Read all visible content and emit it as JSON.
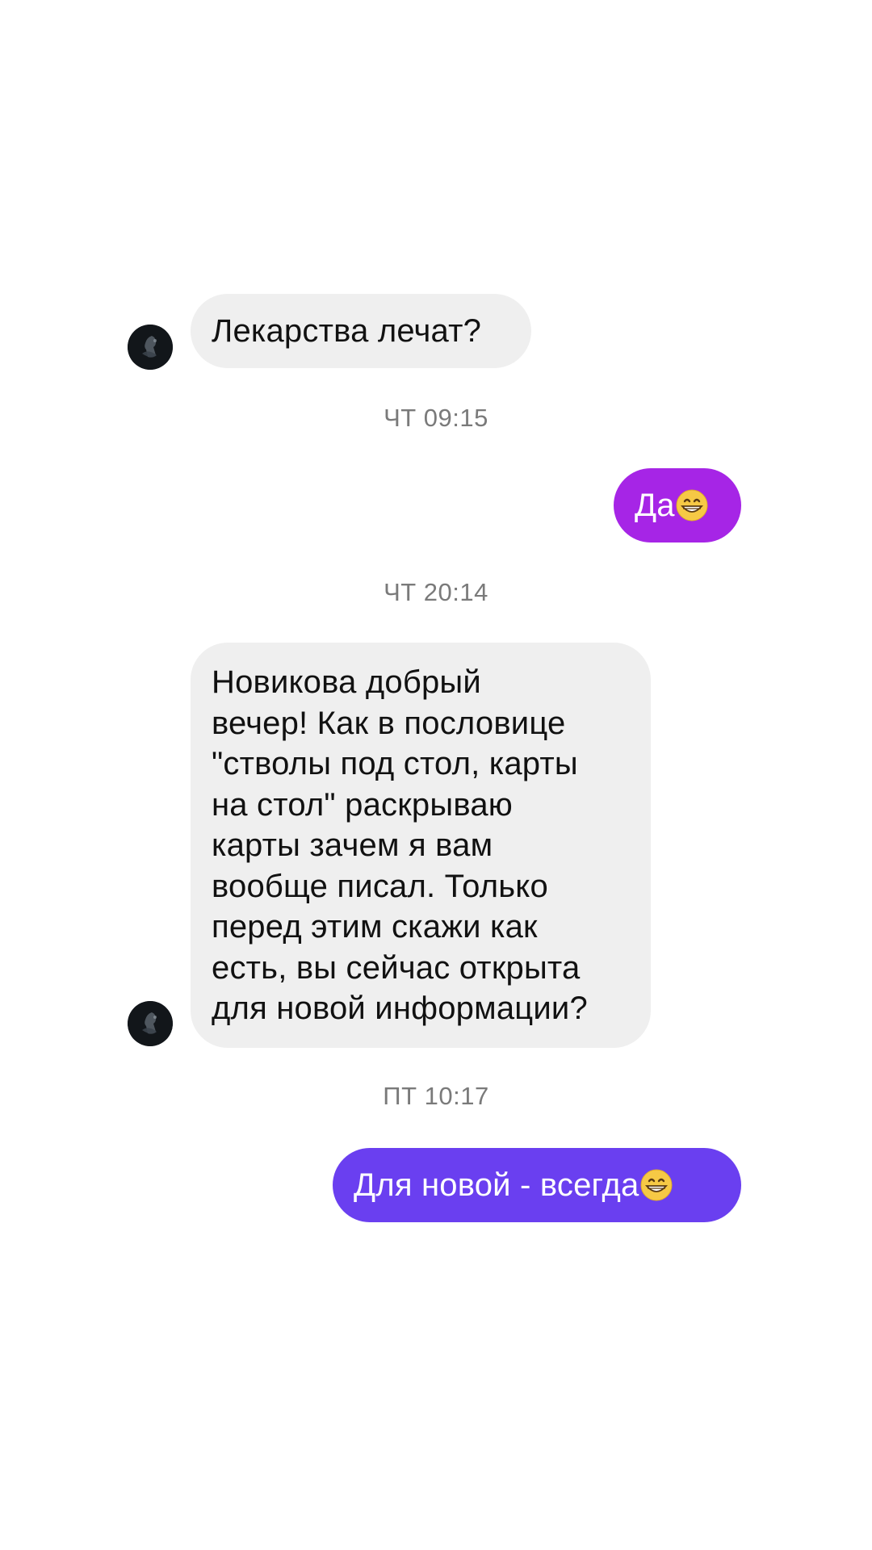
{
  "conversation": {
    "messages": [
      {
        "direction": "incoming",
        "text": "Лекарства лечат?"
      },
      {
        "timestamp": "ЧТ 09:15"
      },
      {
        "direction": "outgoing",
        "text": "Да",
        "emoji": "grinning-face-with-smiling-eyes",
        "color": "#a625e6"
      },
      {
        "timestamp": "ЧТ 20:14"
      },
      {
        "direction": "incoming",
        "text": "Новикова добрый вечер! Как в пословице \"стволы под стол, карты на стол\" раскрываю карты зачем я вам вообще писал. Только перед этим скажи как есть, вы сейчас открыта для новой информации?"
      },
      {
        "timestamp": "ПТ 10:17"
      },
      {
        "direction": "outgoing",
        "text": "Для новой - всегда",
        "emoji": "grinning-face-with-smiling-eyes",
        "color": "#6a3ff0"
      }
    ]
  },
  "m1": {
    "text": "Лекарства лечат?"
  },
  "t1": {
    "text": "ЧТ 09:15"
  },
  "m2": {
    "text": "Да"
  },
  "t2": {
    "text": "ЧТ 20:14"
  },
  "m3": {
    "lines": [
      "Новикова добрый",
      "вечер! Как в пословице",
      "\"стволы под стол, карты",
      "на стол\" раскрываю",
      "карты зачем я вам",
      "вообще писал. Только",
      "перед этим скажи как",
      "есть, вы сейчас открыта",
      "для новой информации?"
    ]
  },
  "t3": {
    "text": "ПТ 10:17"
  },
  "m4": {
    "text": "Для новой - всегда"
  },
  "colors": {
    "incoming_bubble": "#efefef",
    "outgoing_purple": "#a625e6",
    "outgoing_violet": "#6a3ff0",
    "timestamp": "#7a7a7a"
  }
}
